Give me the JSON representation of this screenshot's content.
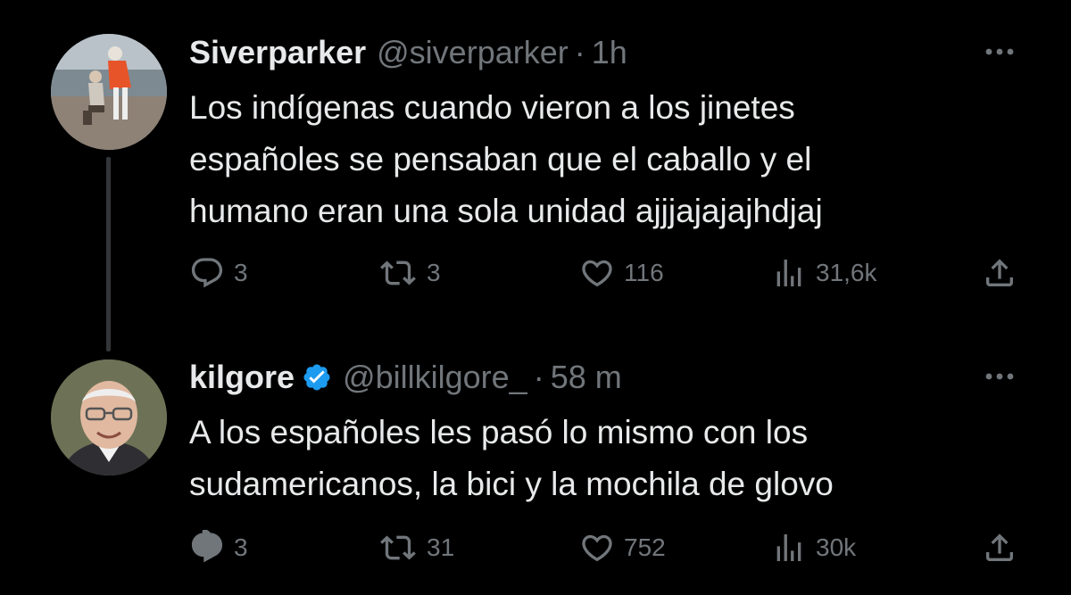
{
  "colors": {
    "background": "#000000",
    "text_primary": "#e7e9ea",
    "text_secondary": "#71767b",
    "thread_line": "#333639",
    "verified_badge": "#1d9bf0"
  },
  "tweets": [
    {
      "display_name": "Siverparker",
      "handle": "@siverparker",
      "separator": "·",
      "time": "1h",
      "verified": false,
      "text_lines": [
        "Los indígenas cuando vieron a los jinetes",
        "españoles se pensaban que el caballo y el",
        "humano eran una sola unidad ajjjajajajhdjaj"
      ],
      "stats": {
        "replies": "3",
        "reposts": "3",
        "likes": "116",
        "views": "31,6k"
      }
    },
    {
      "display_name": "kilgore",
      "handle": "@billkilgore_",
      "separator": "·",
      "time": "58 m",
      "verified": true,
      "text_lines": [
        "A los españoles les pasó lo mismo con los",
        "sudamericanos, la bici y la mochila de glovo"
      ],
      "stats": {
        "replies": "3",
        "reposts": "31",
        "likes": "752",
        "views": "30k"
      }
    }
  ],
  "icons": {
    "reply": "reply-icon",
    "repost": "repost-icon",
    "like": "heart-icon",
    "views": "views-chart-icon",
    "share": "share-icon",
    "more": "more-dots-icon",
    "verified": "verified-badge-icon"
  }
}
